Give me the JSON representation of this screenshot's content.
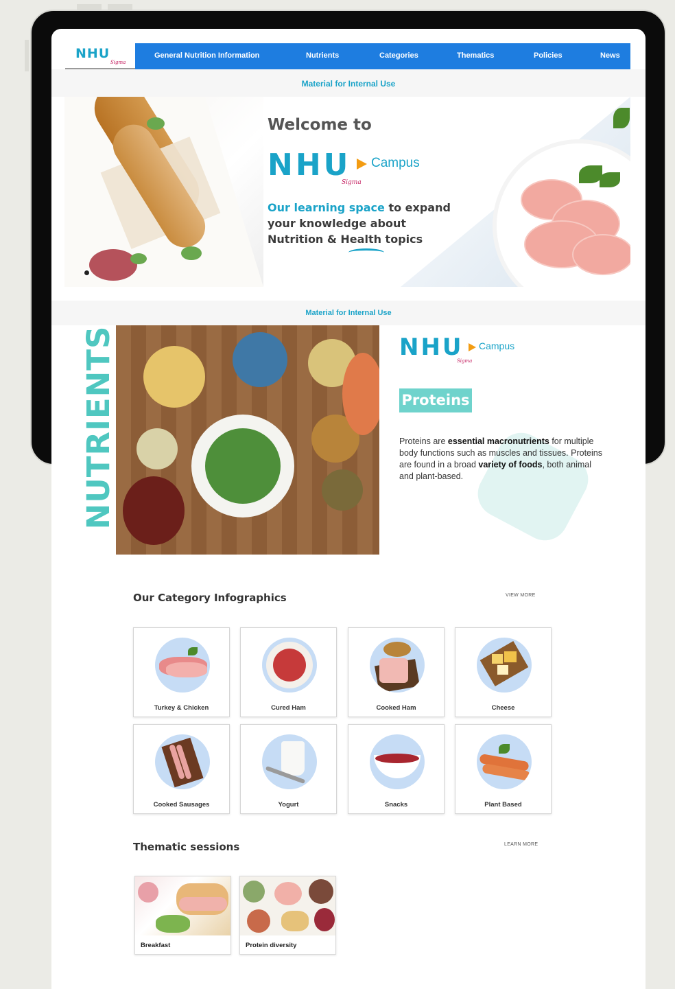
{
  "nav": {
    "logo": "NHU",
    "logo_sub": "Sigma",
    "items": [
      "General Nutrition Information",
      "Nutrients",
      "Categories",
      "Thematics",
      "Policies",
      "News"
    ]
  },
  "internal_label": "Material for Internal Use",
  "hero": {
    "welcome": "Welcome to",
    "logo": "NHU",
    "logo_campus": "Campus",
    "logo_sub": "Sigma",
    "tagline_highlight": "Our learning space",
    "tagline_rest_1": " to expand",
    "tagline_line2": "your knowledge about",
    "tagline_line3": "Nutrition & Health topics"
  },
  "nutrients": {
    "vertical_title": "NUTRIENTS",
    "logo": "NHU",
    "logo_campus": "Campus",
    "logo_sub": "Sigma",
    "pill": "Proteins",
    "desc_1": "Proteins are ",
    "desc_bold_1": "essential macronutrients",
    "desc_2": " for multiple body functions such as muscles and tissues. Proteins are found in a broad ",
    "desc_bold_2": "variety of foods",
    "desc_3": ", both animal and plant-based."
  },
  "categories": {
    "title": "Our Category Infographics",
    "more": "VIEW MORE",
    "items": [
      {
        "label": "Turkey & Chicken",
        "icon": "turkey-chicken-icon"
      },
      {
        "label": "Cured Ham",
        "icon": "cured-ham-icon"
      },
      {
        "label": "Cooked Ham",
        "icon": "cooked-ham-icon"
      },
      {
        "label": "Cheese",
        "icon": "cheese-icon"
      },
      {
        "label": "Cooked Sausages",
        "icon": "cooked-sausages-icon"
      },
      {
        "label": "Yogurt",
        "icon": "yogurt-icon"
      },
      {
        "label": "Snacks",
        "icon": "snacks-icon"
      },
      {
        "label": "Plant Based",
        "icon": "plant-based-icon"
      }
    ]
  },
  "thematics": {
    "title": "Thematic sessions",
    "more": "LEARN MORE",
    "items": [
      {
        "label": "Breakfast"
      },
      {
        "label": "Protein diversity"
      }
    ]
  },
  "colors": {
    "brand_blue": "#1aa3c8",
    "nav_blue": "#1e7de0",
    "teal": "#4fc7c0",
    "accent_orange": "#f39c12"
  }
}
